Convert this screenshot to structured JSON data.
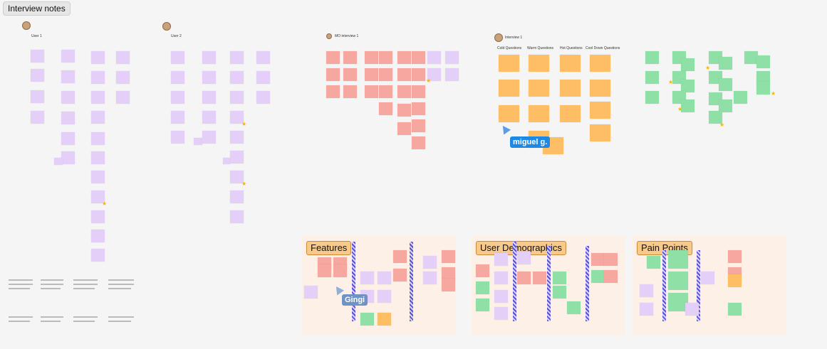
{
  "board": {
    "title": "Interview notes"
  },
  "interviews": {
    "user1": "User 1",
    "user2": "User 2",
    "mo": "MO interview 1",
    "interview1": "Interview 1"
  },
  "questions": {
    "cold": "Cold Questions",
    "warm": "Warm Questions",
    "hot": "Hot Questions",
    "cooldown": "Cool Down Questions"
  },
  "sections": {
    "features": "Features",
    "demographics": "User Demographics",
    "pain_points": "Pain Points"
  },
  "cursors": [
    {
      "name": "miguel g.",
      "color": "#1e88e5"
    },
    {
      "name": "Gingi",
      "color": "#6f93c4"
    }
  ]
}
